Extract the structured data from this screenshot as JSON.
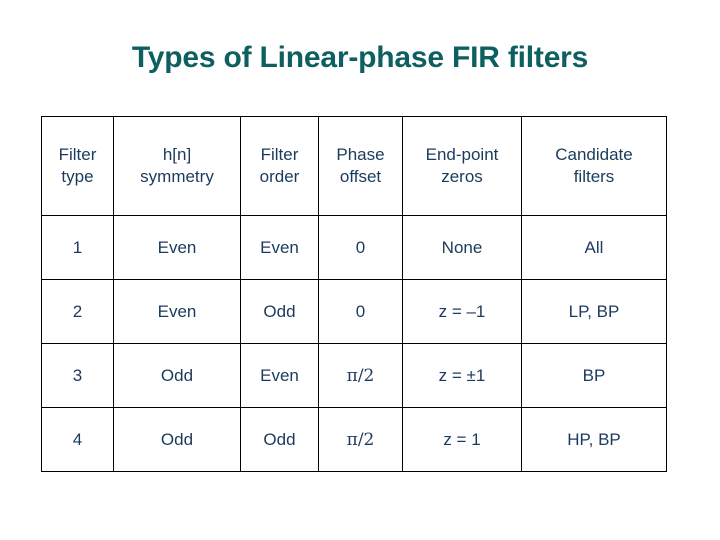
{
  "slide": {
    "title": "Types of Linear-phase FIR filters",
    "title_color": "#0d5f60",
    "text_color": "#1b3a5c",
    "background": "#ffffff",
    "border_color": "#000000"
  },
  "table": {
    "headers": [
      {
        "line1": "Filter",
        "line2": "type"
      },
      {
        "line1": "h[n]",
        "line2": "symmetry"
      },
      {
        "line1": "Filter",
        "line2": "order"
      },
      {
        "line1": "Phase",
        "line2": "offset"
      },
      {
        "line1": "End-point",
        "line2": "zeros"
      },
      {
        "line1": "Candidate",
        "line2": "filters"
      }
    ],
    "rows": [
      {
        "filter_type": "1",
        "hn_symmetry": "Even",
        "filter_order": "Even",
        "phase_offset": "0",
        "endpoint_zeros": "None",
        "candidate_filters": "All"
      },
      {
        "filter_type": "2",
        "hn_symmetry": "Even",
        "filter_order": "Odd",
        "phase_offset": "0",
        "endpoint_zeros": "z = –1",
        "candidate_filters": "LP, BP"
      },
      {
        "filter_type": "3",
        "hn_symmetry": "Odd",
        "filter_order": "Even",
        "phase_offset": "π/2",
        "endpoint_zeros": "z = ±1",
        "candidate_filters": "BP"
      },
      {
        "filter_type": "4",
        "hn_symmetry": "Odd",
        "filter_order": "Odd",
        "phase_offset": "π/2",
        "endpoint_zeros": "z = 1",
        "candidate_filters": "HP, BP"
      }
    ]
  }
}
